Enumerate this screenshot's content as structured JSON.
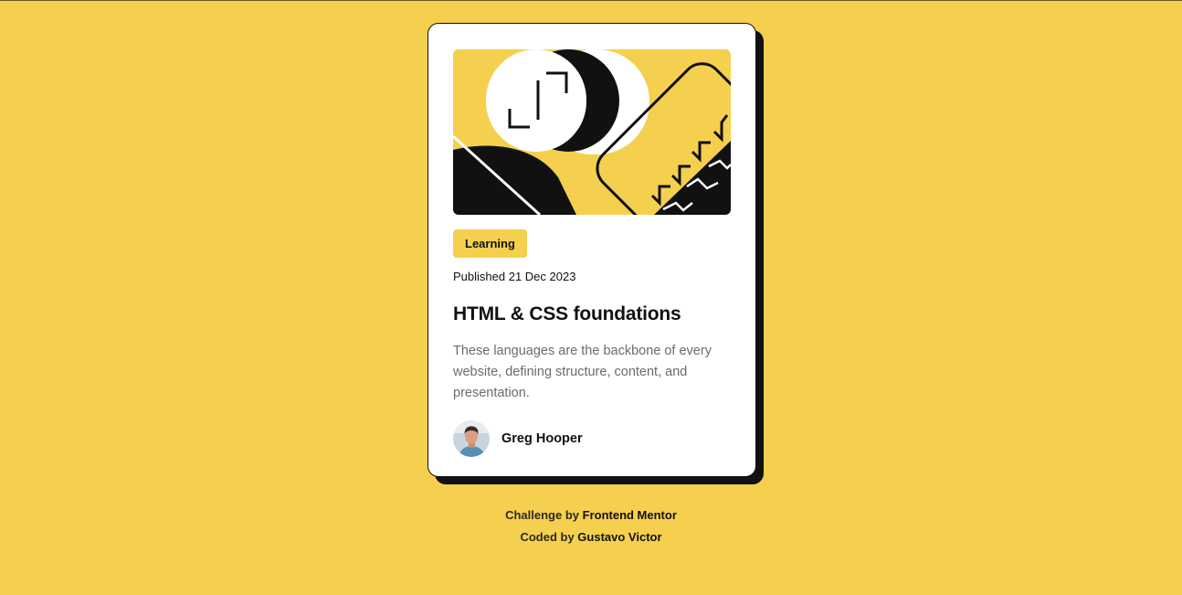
{
  "card": {
    "tag": "Learning",
    "published": "Published 21 Dec 2023",
    "title": "HTML & CSS foundations",
    "description": "These languages are the backbone of every website, defining structure, content, and presentation.",
    "author": "Greg Hooper",
    "hero_icon": "abstract-illustration",
    "avatar_icon": "author-avatar"
  },
  "attribution": {
    "line1_prefix": "Challenge by ",
    "line1_link": "Frontend Mentor",
    "line2_prefix": "Coded by ",
    "line2_link": "Gustavo Victor"
  },
  "colors": {
    "background": "#f4d04e",
    "card": "#ffffff",
    "ink": "#111111",
    "muted": "#6b6b6b"
  }
}
